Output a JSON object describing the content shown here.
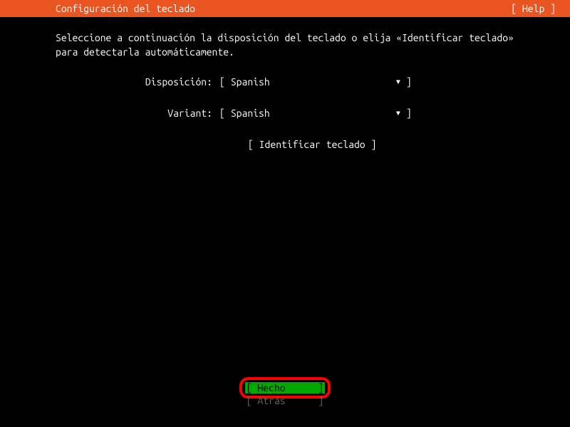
{
  "header": {
    "title": "Configuración del teclado",
    "help": "[ Help ]"
  },
  "instructions": "Seleccione a continuación la disposición del teclado o elija «Identificar teclado» para detectarla automáticamente.",
  "form": {
    "layout": {
      "label": "Disposición:",
      "value": "Spanish"
    },
    "variant": {
      "label": "Variant:",
      "value": "Spanish"
    }
  },
  "identify_button": "[ Identificar teclado ]",
  "buttons": {
    "done": "Hecho",
    "back": "Atrás"
  }
}
